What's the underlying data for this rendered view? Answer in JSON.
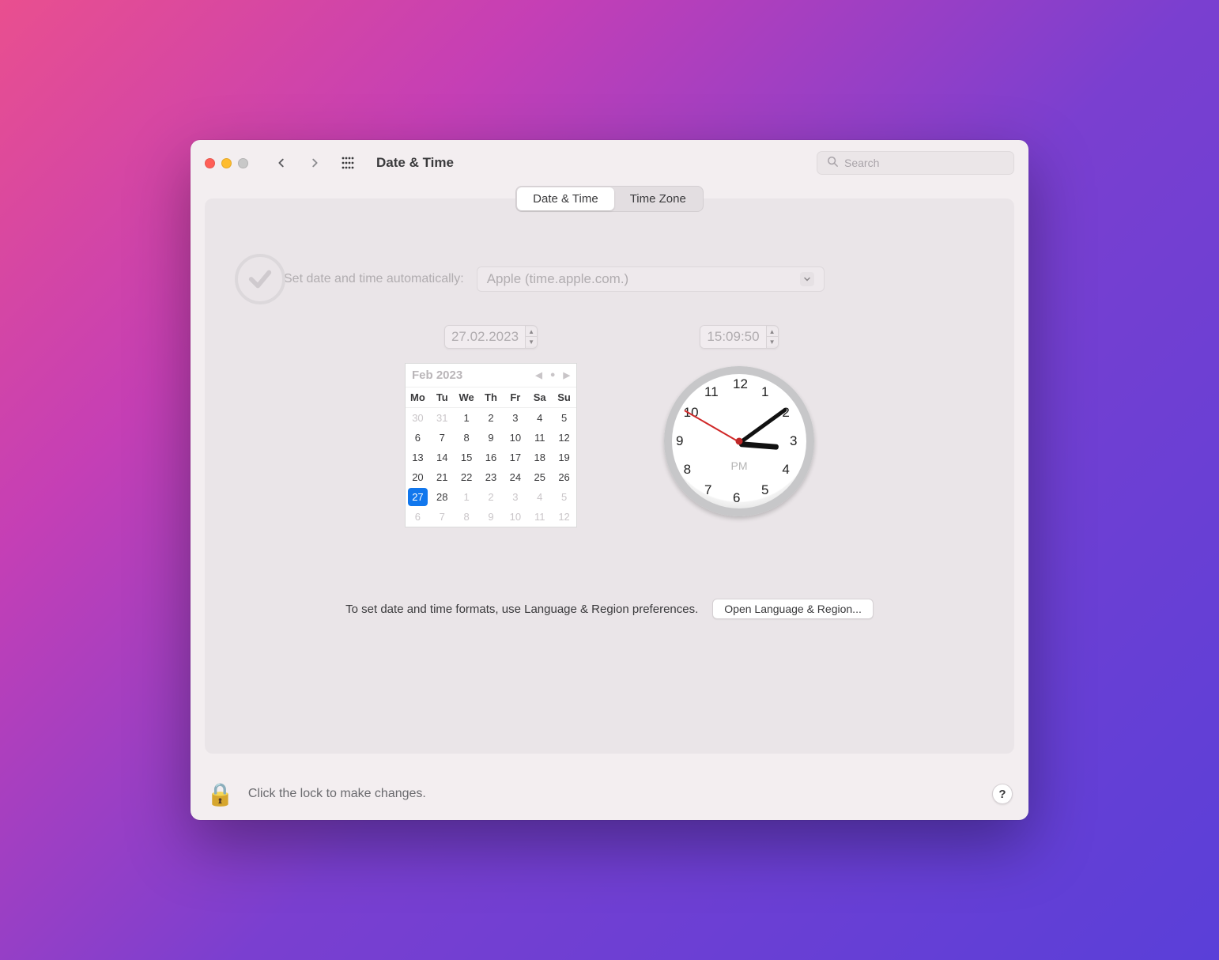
{
  "window": {
    "title": "Date & Time"
  },
  "search": {
    "placeholder": "Search"
  },
  "tabs": {
    "date_time": "Date & Time",
    "time_zone": "Time Zone",
    "active": "date_time"
  },
  "auto": {
    "label": "Set date and time automatically:",
    "server": "Apple (time.apple.com.)",
    "checked": true,
    "locked": true
  },
  "date_field": "27.02.2023",
  "time_field": "15:09:50",
  "calendar": {
    "title": "Feb 2023",
    "dow": [
      "Mo",
      "Tu",
      "We",
      "Th",
      "Fr",
      "Sa",
      "Su"
    ],
    "weeks": [
      [
        {
          "d": "30",
          "dim": true
        },
        {
          "d": "31",
          "dim": true
        },
        {
          "d": "1"
        },
        {
          "d": "2"
        },
        {
          "d": "3"
        },
        {
          "d": "4"
        },
        {
          "d": "5"
        }
      ],
      [
        {
          "d": "6"
        },
        {
          "d": "7"
        },
        {
          "d": "8"
        },
        {
          "d": "9"
        },
        {
          "d": "10"
        },
        {
          "d": "11"
        },
        {
          "d": "12"
        }
      ],
      [
        {
          "d": "13"
        },
        {
          "d": "14"
        },
        {
          "d": "15"
        },
        {
          "d": "16"
        },
        {
          "d": "17"
        },
        {
          "d": "18"
        },
        {
          "d": "19"
        }
      ],
      [
        {
          "d": "20"
        },
        {
          "d": "21"
        },
        {
          "d": "22"
        },
        {
          "d": "23"
        },
        {
          "d": "24"
        },
        {
          "d": "25"
        },
        {
          "d": "26"
        }
      ],
      [
        {
          "d": "27",
          "sel": true
        },
        {
          "d": "28"
        },
        {
          "d": "1",
          "dim": true
        },
        {
          "d": "2",
          "dim": true
        },
        {
          "d": "3",
          "dim": true
        },
        {
          "d": "4",
          "dim": true
        },
        {
          "d": "5",
          "dim": true
        }
      ],
      [
        {
          "d": "6",
          "dim": true
        },
        {
          "d": "7",
          "dim": true
        },
        {
          "d": "8",
          "dim": true
        },
        {
          "d": "9",
          "dim": true
        },
        {
          "d": "10",
          "dim": true
        },
        {
          "d": "11",
          "dim": true
        },
        {
          "d": "12",
          "dim": true
        }
      ]
    ]
  },
  "clock": {
    "hour": 3,
    "minute": 9,
    "second": 50,
    "ampm": "PM",
    "numbers": [
      "12",
      "1",
      "2",
      "3",
      "4",
      "5",
      "6",
      "7",
      "8",
      "9",
      "10",
      "11"
    ]
  },
  "hint": {
    "text": "To set date and time formats, use Language & Region preferences.",
    "button": "Open Language & Region..."
  },
  "footer": {
    "lock_text": "Click the lock to make changes.",
    "help": "?"
  }
}
